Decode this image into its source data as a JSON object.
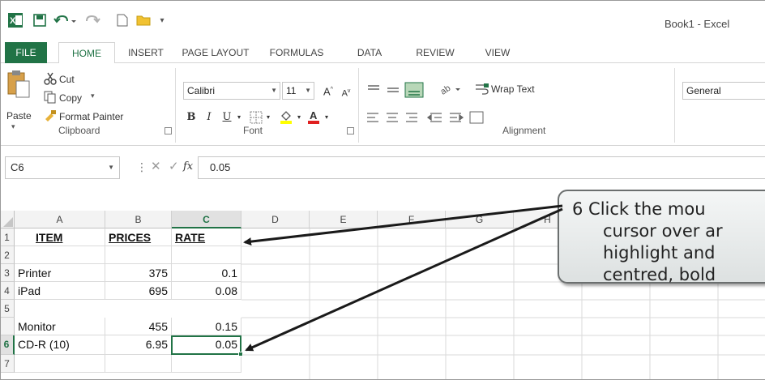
{
  "window": {
    "title": "Book1 - Excel"
  },
  "quick_access": [
    "excel-logo-icon",
    "save-icon",
    "undo-icon",
    "redo-icon",
    "new-file-icon",
    "open-folder-icon",
    "customize-icon"
  ],
  "tabs": [
    "FILE",
    "HOME",
    "INSERT",
    "PAGE LAYOUT",
    "FORMULAS",
    "DATA",
    "REVIEW",
    "VIEW"
  ],
  "ribbon": {
    "clipboard": {
      "paste": "Paste",
      "cut": "Cut",
      "copy": "Copy",
      "format_painter": "Format Painter",
      "label": "Clipboard"
    },
    "font": {
      "name": "Calibri",
      "size": "11",
      "bold": "B",
      "italic": "I",
      "underline": "U",
      "grow": "A",
      "shrink": "A",
      "label": "Font"
    },
    "alignment": {
      "wrap_text": "Wrap Text",
      "label": "Alignment"
    },
    "number": {
      "format": "General"
    }
  },
  "formula_bar": {
    "name_box": "C6",
    "fx": "fx",
    "value": "0.05"
  },
  "columns": [
    "A",
    "B",
    "C",
    "D",
    "E",
    "F",
    "G",
    "H"
  ],
  "rows": [
    "1",
    "2",
    "3",
    "4",
    "5",
    "6",
    "7"
  ],
  "cells": {
    "A1": "ITEM",
    "B1": "PRICES",
    "C1": "RATE",
    "A3": "Printer",
    "B3": "375",
    "C3": "0.1",
    "A4": "iPad",
    "B4": "695",
    "C4": "0.08",
    "A5": "Monitor",
    "B5": "455",
    "C5": "0.15",
    "A6": "CD-R (10)",
    "B6": "6.95",
    "C6": "0.05"
  },
  "callout": {
    "lines": [
      "6  Click the mou",
      "cursor over ar",
      "highlight and",
      "centred, bold"
    ]
  },
  "colors": {
    "excel_green": "#217346",
    "callout_border": "#6b6f6f",
    "arrow": "#1a1a1a"
  }
}
